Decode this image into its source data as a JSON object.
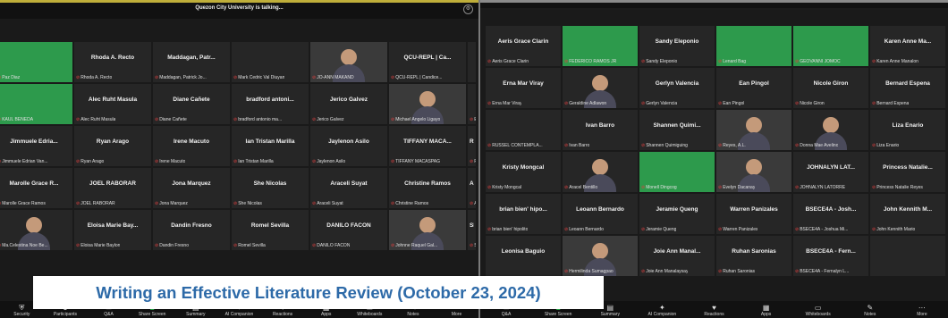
{
  "left_window": {
    "title": "Quezon City University is talking...",
    "tiles": [
      {
        "kind": "green",
        "caption": "Paz Diaz"
      },
      {
        "name": "Rhoda A. Recto",
        "caption": "Rhoda A. Recto"
      },
      {
        "name": "Maddagan, Patr...",
        "caption": "Maddagan, Patrick Jo..."
      },
      {
        "kind": "dark",
        "caption": "Mark Cedric Val Diuyan"
      },
      {
        "kind": "video",
        "caption": "JO-ANN MAKAND"
      },
      {
        "name": "QCU-REPL | Ca...",
        "caption": "QCU-REPL | Candice..."
      },
      {
        "name": "",
        "caption": ""
      },
      {
        "kind": "green",
        "caption": "KAUL BENEDA"
      },
      {
        "name": "Alec Ruht Masula",
        "caption": "Alec Ruht Masula"
      },
      {
        "name": "Diane Cañete",
        "caption": "Diane Cañete"
      },
      {
        "name": "bradford antoni...",
        "caption": "bradford antonio ma..."
      },
      {
        "name": "Jerico Galvez",
        "caption": "Jerico Galvez"
      },
      {
        "kind": "video",
        "caption": "Michael Angelo Ligayo"
      },
      {
        "name": "",
        "caption": "Edi"
      },
      {
        "name": "Jimmuele Edria...",
        "caption": "Jimmuele Edrian Van..."
      },
      {
        "name": "Ryan Arago",
        "caption": "Ryan Arago"
      },
      {
        "name": "Irene Macuto",
        "caption": "Irene Macuto"
      },
      {
        "name": "Ian Tristan Marilla",
        "caption": "Ian Tristan Marilla"
      },
      {
        "name": "Jaylenon Asilo",
        "caption": "Jaylenon Asilo"
      },
      {
        "name": "TIFFANY MACA...",
        "caption": "TIFFANY MACASPAG"
      },
      {
        "name": "Ri",
        "caption": "Ro"
      },
      {
        "name": "Marolle Grace R...",
        "caption": "Marolle Grace Ramos"
      },
      {
        "name": "JOEL RABORAR",
        "caption": "JOEL RABORAR"
      },
      {
        "name": "Jona Marquez",
        "caption": "Jona Marquez"
      },
      {
        "name": "She Nicolas",
        "caption": "She Nicolas"
      },
      {
        "name": "Araceli Suyat",
        "caption": "Araceli Suyat"
      },
      {
        "name": "Christine Ramos",
        "caption": "Christine Ramos"
      },
      {
        "name": "Aur",
        "caption": "Aur"
      },
      {
        "kind": "person",
        "caption": "Ma.Celestina Noe Be..."
      },
      {
        "name": "Eloisa Marie Bay...",
        "caption": "Eloisa Marie Baylon"
      },
      {
        "name": "Dandin Fresno",
        "caption": "Dandin Fresno"
      },
      {
        "name": "Romel Sevilla",
        "caption": "Romel Sevilla"
      },
      {
        "name": "DANILO FACON",
        "caption": "DANILO FACON"
      },
      {
        "kind": "video",
        "caption": "Johnne Raquel Gal..."
      },
      {
        "name": "SFE",
        "caption": "SFE"
      }
    ],
    "toolbar": [
      {
        "label": "Security",
        "icon": "shield"
      },
      {
        "label": "Participants",
        "icon": "people"
      },
      {
        "label": "Q&A",
        "icon": "qa"
      },
      {
        "label": "Share Screen",
        "icon": "share",
        "accent": true
      },
      {
        "label": "Summary",
        "icon": "doc"
      },
      {
        "label": "AI Companion",
        "icon": "spark"
      },
      {
        "label": "Reactions",
        "icon": "heart"
      },
      {
        "label": "Apps",
        "icon": "apps"
      },
      {
        "label": "Whiteboards",
        "icon": "board"
      },
      {
        "label": "Notes",
        "icon": "notes"
      },
      {
        "label": "More",
        "icon": "more"
      }
    ]
  },
  "right_window": {
    "tiles": [
      {
        "name": "Aeris Grace Clarin",
        "caption": "Aeris Grace Clarin"
      },
      {
        "kind": "green",
        "caption": "FEDERICO RAMOS JR"
      },
      {
        "name": "Sandy Eleponio",
        "caption": "Sandy Eleponio"
      },
      {
        "kind": "green",
        "caption": "Lenard Bag"
      },
      {
        "kind": "green",
        "caption": "GEOVANNI JOMOC"
      },
      {
        "name": "Karen Anne Ma...",
        "caption": "Karen Anne Manalon"
      },
      {
        "name": "Erna Mar Viray",
        "caption": "Erna Mar Viray"
      },
      {
        "kind": "person",
        "caption": "Geraldine Adlawon"
      },
      {
        "name": "Gerlyn Valencia",
        "caption": "Gerlyn Valencia"
      },
      {
        "name": "Ean Pingol",
        "caption": "Ean Pingol"
      },
      {
        "name": "Nicole Giron",
        "caption": "Nicole Giron"
      },
      {
        "name": "Bernard Espena",
        "caption": "Bernard Espena"
      },
      {
        "name": "",
        "caption": "RUSSEL CONTEMPLA..."
      },
      {
        "name": "Ivan Barro",
        "caption": "Ivan Barro"
      },
      {
        "name": "Shannen Quimi...",
        "caption": "Shannen Quimiguing"
      },
      {
        "kind": "video",
        "caption": "Reyes, A.L."
      },
      {
        "kind": "person",
        "caption": "Donna Mae Avelino"
      },
      {
        "name": "Liza Enario",
        "caption": "Liza Enario"
      },
      {
        "name": "Kristy Mongcal",
        "caption": "Kristy Mongcal"
      },
      {
        "kind": "person",
        "caption": "Aracel Bentillo"
      },
      {
        "kind": "green",
        "caption": "Monell Dingcog"
      },
      {
        "kind": "video",
        "caption": "Evelyn Dacanay"
      },
      {
        "name": "JOHNALYN LAT...",
        "caption": "JOHNALYN LATORRE"
      },
      {
        "name": "Princess Natalie...",
        "caption": "Princess Natalie Reyes"
      },
      {
        "name": "brian bien' hipo...",
        "caption": "brian bien' hipolito"
      },
      {
        "name": "Leoann Bernardo",
        "caption": "Leoann Bernardo"
      },
      {
        "name": "Jeramie Queng",
        "caption": "Jeramie Queng"
      },
      {
        "name": "Warren Panizales",
        "caption": "Warren Panizales"
      },
      {
        "name": "BSECE4A - Josh...",
        "caption": "BSECE4A - Joshua Mi..."
      },
      {
        "name": "John Kennith M...",
        "caption": "John Kennith Mario"
      },
      {
        "name": "Leonisa Baguio",
        "caption": ""
      },
      {
        "kind": "video",
        "caption": "Hermilinda Sumagpao"
      },
      {
        "name": "Joie Ann Manal...",
        "caption": "Joie Ann Manalaysay"
      },
      {
        "name": "Ruhan Saronias",
        "caption": "Ruhan Saronias"
      },
      {
        "name": "BSECE4A - Fern...",
        "caption": "BSECE4A - Fernalyn L..."
      },
      {
        "name": "",
        "caption": ""
      }
    ],
    "toolbar": [
      {
        "label": "Q&A",
        "icon": "qa"
      },
      {
        "label": "Share Screen",
        "icon": "share",
        "accent": true
      },
      {
        "label": "Summary",
        "icon": "doc"
      },
      {
        "label": "AI Companion",
        "icon": "spark"
      },
      {
        "label": "Reactions",
        "icon": "heart"
      },
      {
        "label": "Apps",
        "icon": "apps"
      },
      {
        "label": "Whiteboards",
        "icon": "board"
      },
      {
        "label": "Notes",
        "icon": "notes"
      },
      {
        "label": "More",
        "icon": "more"
      }
    ]
  },
  "caption_banner": "Writing an Effective Literature Review (October 23, 2024)",
  "colors": {
    "accent_green": "#2bb24c",
    "mute_red": "#e04040",
    "caption_text": "#2d6aa8"
  }
}
